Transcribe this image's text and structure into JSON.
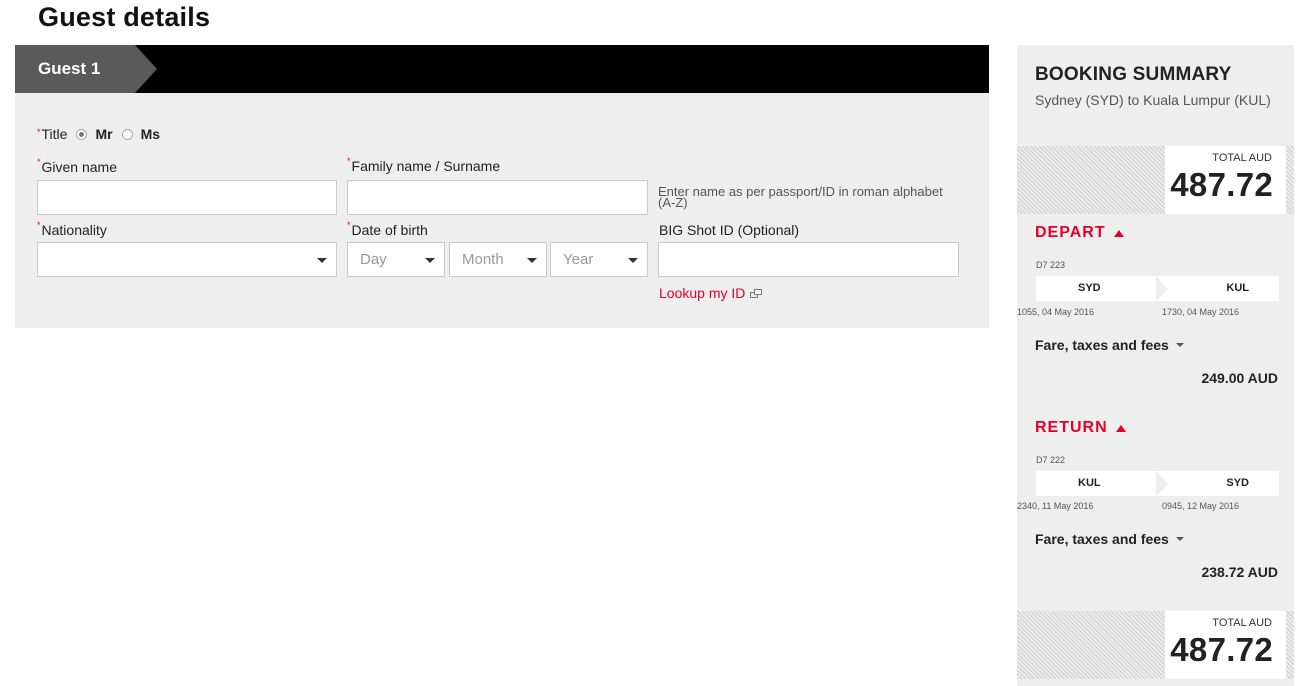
{
  "page": {
    "title": "Guest details"
  },
  "guest": {
    "tab_label": "Guest 1",
    "title_label": "Title",
    "title_options": [
      "Mr",
      "Ms"
    ],
    "title_selected": "Mr",
    "given_name_label": "Given name",
    "given_name_value": "",
    "family_name_label": "Family name / Surname",
    "family_name_value": "",
    "name_hint": "Enter name as per passport/ID in roman alphabet (A-Z)",
    "nationality_label": "Nationality",
    "nationality_value": "",
    "dob_label": "Date of birth",
    "dob_day": "Day",
    "dob_month": "Month",
    "dob_year": "Year",
    "bigshot_label": "BIG Shot ID (Optional)",
    "bigshot_value": "",
    "lookup_link": "Lookup my ID"
  },
  "summary": {
    "title": "BOOKING SUMMARY",
    "route": "Sydney (SYD) to Kuala Lumpur (KUL)",
    "total_label": "TOTAL AUD",
    "total_value": "487.72",
    "depart": {
      "heading": "DEPART",
      "flight_no": "D7 223",
      "from": "SYD",
      "to": "KUL",
      "from_time": "1055, 04 May 2016",
      "to_time": "1730, 04 May 2016",
      "fare_label": "Fare, taxes and fees",
      "fare_amount": "249.00 AUD"
    },
    "return": {
      "heading": "RETURN",
      "flight_no": "D7 222",
      "from": "KUL",
      "to": "SYD",
      "from_time": "2340, 11 May 2016",
      "to_time": "0945, 12 May 2016",
      "fare_label": "Fare, taxes and fees",
      "fare_amount": "238.72 AUD"
    }
  },
  "colors": {
    "accent_red": "#e4002b",
    "header_black": "#000000",
    "tab_grey": "#5a5a5a",
    "panel_bg": "#eeeeee"
  }
}
